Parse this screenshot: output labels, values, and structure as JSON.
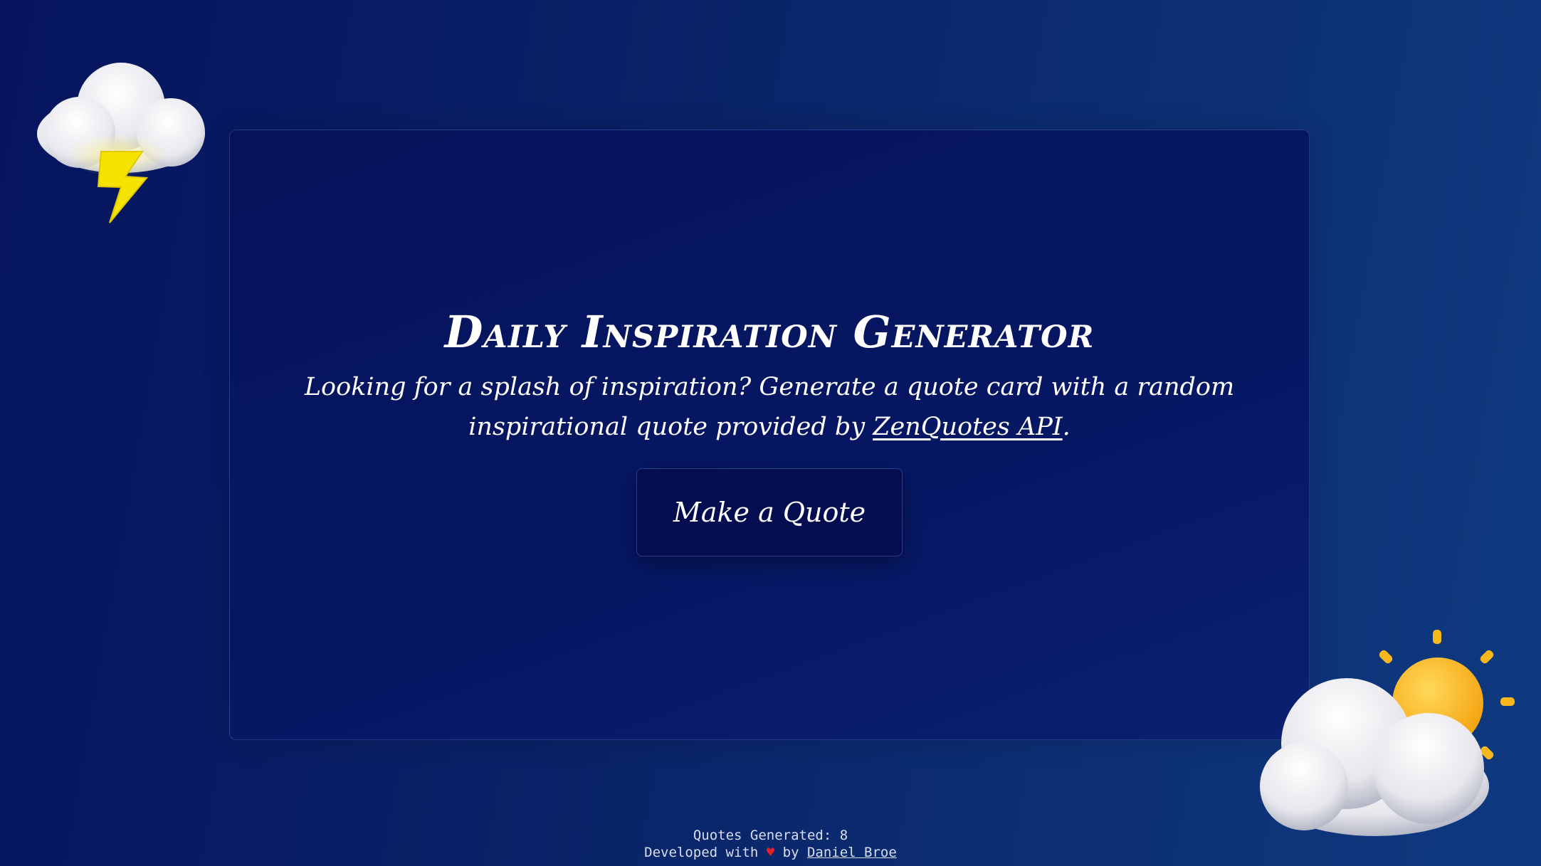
{
  "app": {
    "title": "Daily Inspiration Generator",
    "subtitle_before_link": "Looking for a splash of inspiration? Generate a quote card with a random inspirational quote provided by ",
    "subtitle_link": "ZenQuotes API",
    "subtitle_after_link": ".",
    "button_label": "Make a Quote"
  },
  "footer": {
    "counter_label": "Quotes Generated: ",
    "counter_value": "8",
    "developed_prefix": "Developed with ",
    "heart": "♥",
    "developed_by": " by ",
    "author": "Daniel Broe"
  },
  "decorations": {
    "top_left": "storm-cloud-icon",
    "bottom_right": "sun-behind-cloud-icon"
  },
  "colors": {
    "background": "#0a2468",
    "card": "#05135a",
    "button": "#040d50",
    "heart": "#e0202a",
    "lightning": "#f5e400",
    "sun": "#f9b81a"
  }
}
